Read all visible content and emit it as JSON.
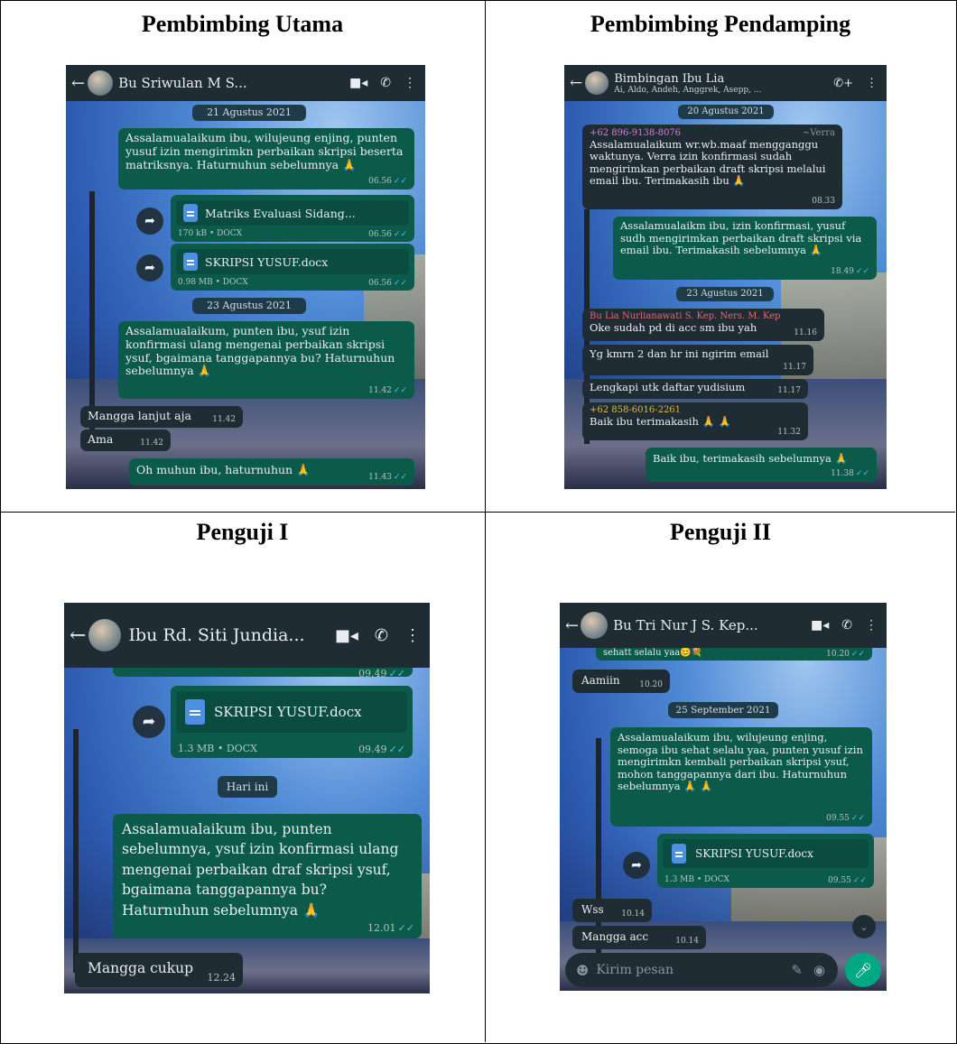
{
  "cells": {
    "pu": {
      "title": "Pembimbing Utama"
    },
    "pp": {
      "title": "Pembimbing Pendamping"
    },
    "p1": {
      "title": "Penguji I"
    },
    "p2": {
      "title": "Penguji II"
    }
  },
  "chat1": {
    "contact": "Bu Sriwulan M S...",
    "date1": "21 Agustus 2021",
    "m1": {
      "text": "Assalamualaikum ibu, wilujeung enjing, punten yusuf izin mengirimkn perbaikan skripsi beserta matriksnya. Haturnuhun sebelumnya 🙏",
      "time": "06.56"
    },
    "doc1": {
      "name": "Matriks Evaluasi Sidang...",
      "meta": "170 kB • DOCX",
      "time": "06.56"
    },
    "doc2": {
      "name": "SKRIPSI YUSUF.docx",
      "meta": "0.98 MB • DOCX",
      "time": "06.56"
    },
    "date2": "23 Agustus 2021",
    "m2": {
      "text": "Assalamualaikum, punten ibu, ysuf izin konfirmasi ulang mengenai perbaikan skripsi ysuf, bgaimana tanggapannya bu? Haturnuhun sebelumnya 🙏",
      "time": "11.42"
    },
    "r1": {
      "text": "Mangga lanjut aja",
      "time": "11.42"
    },
    "r2": {
      "text": "Ama",
      "time": "11.42"
    },
    "m3": {
      "text": "Oh muhun ibu, haturnuhun 🙏",
      "time": "11.43"
    }
  },
  "chat2": {
    "contact": "Bimbingan Ibu Lia",
    "members": "Ai, Aldo, Andeh, Anggrek, Asepp, ...",
    "date1": "20 Agustus 2021",
    "m1": {
      "sender": "+62 896-9138-8076",
      "alias": "~Verra",
      "text": "Assalamualaikum wr.wb.maaf mengganggu waktunya. Verra izin konfirmasi sudah mengirimkan perbaikan draft skripsi melalui email ibu. Terimakasih ibu 🙏",
      "time": "08.33"
    },
    "m2": {
      "text": "Assalamualaikm ibu, izin konfirmasi, yusuf sudh mengirimkan perbaikan draft skripsi via email ibu. Terimakasih sebelumnya 🙏",
      "time": "18.49"
    },
    "date2": "23 Agustus 2021",
    "r1": {
      "sender": "Bu Lia Nurlianawati S. Kep. Ners. M. Kep",
      "text": "Oke sudah pd di acc sm ibu yah",
      "time": "11.16"
    },
    "r2": {
      "text": "Yg kmrn 2 dan hr ini ngirim email",
      "time": "11.17"
    },
    "r3": {
      "text": "Lengkapi utk daftar yudisium",
      "time": "11.17"
    },
    "r4": {
      "sender": "+62 858-6016-2261",
      "text": "Baik ibu terimakasih 🙏 🙏",
      "time": "11.32"
    },
    "m3": {
      "text": "Baik ibu, terimakasih sebelumnya 🙏",
      "time": "11.38"
    }
  },
  "chat3": {
    "contact": "Ibu Rd. Siti Jundia...",
    "prev_time": "09.49",
    "doc1": {
      "name": "SKRIPSI YUSUF.docx",
      "meta": "1.3 MB • DOCX",
      "time": "09.49"
    },
    "date1": "Hari ini",
    "m1": {
      "text": "Assalamualaikum ibu, punten sebelumnya, ysuf izin konfirmasi ulang mengenai perbaikan draf skripsi ysuf, bgaimana tanggapannya bu? Haturnuhun sebelumnya 🙏",
      "time": "12.01"
    },
    "r1": {
      "text": "Mangga cukup",
      "time": "12.24"
    }
  },
  "chat4": {
    "contact": "Bu Tri Nur J S. Kep...",
    "prev_text": "sehatt selalu yaa😊💐",
    "prev_time": "10.20",
    "r0": {
      "text": "Aamiin",
      "time": "10.20"
    },
    "date1": "25 September 2021",
    "m1": {
      "text": "Assalamualaikum ibu, wilujeung enjing, semoga ibu sehat selalu yaa, punten yusuf izin mengirimkn kembali perbaikan skripsi ysuf, mohon tanggapannya dari ibu. Haturnuhun sebelumnya 🙏 🙏",
      "time": "09.55"
    },
    "doc1": {
      "name": "SKRIPSI YUSUF.docx",
      "meta": "1.3 MB • DOCX",
      "time": "09.55"
    },
    "r1": {
      "text": "Wss",
      "time": "10.14"
    },
    "r2": {
      "text": "Mangga acc",
      "time": "10.14"
    },
    "input_placeholder": "Kirim pesan"
  },
  "colors": {
    "outgoing": "#0b5a4a",
    "incoming": "#1f2c34",
    "header": "#1f2c34",
    "accent": "#00a884",
    "ticks": "#53bdeb"
  }
}
